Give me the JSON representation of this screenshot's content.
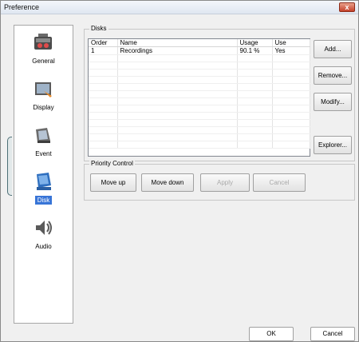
{
  "window": {
    "title": "Preference",
    "close_glyph": "x"
  },
  "sidebar": {
    "items": [
      {
        "label": "General",
        "icon": "settings-tool-icon"
      },
      {
        "label": "Display",
        "icon": "display-icon"
      },
      {
        "label": "Event",
        "icon": "event-icon"
      },
      {
        "label": "Disk",
        "icon": "disk-icon",
        "selected": true
      },
      {
        "label": "Audio",
        "icon": "audio-icon"
      }
    ]
  },
  "disks": {
    "group_label": "Disks",
    "columns": [
      "Order",
      "Name",
      "Usage",
      "Use"
    ],
    "rows": [
      {
        "order": "1",
        "name": "Recordings",
        "usage": "90.1 %",
        "use": "Yes"
      }
    ],
    "buttons": {
      "add": "Add...",
      "remove": "Remove...",
      "modify": "Modify...",
      "explorer": "Explorer..."
    }
  },
  "priority": {
    "group_label": "Priority Control",
    "buttons": {
      "move_up": "Move up",
      "move_down": "Move down",
      "apply": "Apply",
      "cancel": "Cancel"
    }
  },
  "footer": {
    "ok": "OK",
    "cancel": "Cancel"
  }
}
